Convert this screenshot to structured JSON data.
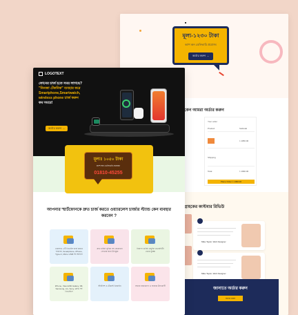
{
  "back_page": {
    "price_badge": {
      "title": "মূল্য-১২৩০ টাকা",
      "subtitle": "ক্যাশ অন ডেলিভারি প্রযোজ্য",
      "button": "অর্ডার করুন →"
    },
    "order_section_title": "কেন আমরা অর্ডার করুন",
    "order_box": {
      "heading": "Your order",
      "col_product": "Product",
      "col_subtotal": "Subtotal",
      "shipping_label": "Shipping",
      "total_label": "Total",
      "total_value": "৳ 1090.00",
      "subtotal_value": "৳ 1050.00",
      "place_order": "Place Order ৳ 1090.00"
    },
    "review_title": "গ্রাহকের কাস্টমার রিভিউ",
    "reviews": [
      {
        "name": "Mike Taylor, Web Designer"
      },
      {
        "name": "Mike Taylor, Web Designer"
      }
    ],
    "navy_panel": {
      "title": "জানাতে অর্ডার করুন",
      "button": "অর্ডার করুন"
    }
  },
  "front_page": {
    "logo": "LOGOTEXT",
    "hero_lines": [
      "ফোনের চার্জ হতে সময় লাগছে?",
      "\"নিনজা টেকনিক\" ব্যবহার করে",
      "Smartphone,Smartwatch,",
      "wireless phone চার্জ করুন",
      "কম সময়ে!"
    ],
    "hero_button": "অর্ডার করুন →",
    "watch_time": "7:09",
    "price_card": {
      "price": "মূল্যঃ ১০৫০ টাকা",
      "note": "ক্যাশ অন ডেলিভারি প্রযোজ্য",
      "phone": "01810-45255"
    },
    "question": "আপনার স্মার্টফোনকে দ্রুত চার্জ করতে ওয়্যারলেস চার্জার স্ট্যান্ড কেন ব্যবহার করবেন ?",
    "tiles": [
      {
        "text": "একসাথে ৩টি ডিভাইস চার্জ করতে পারবেন, Smartphone, iPhone, Type-C, Micro USB সহ অন্যান্য",
        "color": "#e4f1fb"
      },
      {
        "text": "দ্রুত চার্জিং সুবিধা সহ যেকোনো ফোনের জন্য উপযুক্ত",
        "color": "#f9e3ea"
      },
      {
        "text": "নিরাপদ চার্জিং প্রযুক্তি ওভারহিটিং থেকে সুরক্ষা",
        "color": "#eaf5e2"
      },
      {
        "text": "iPhone, Xiaomi/Mi Galaxy, S8, Samsung, LG, Sony, HTC সব ডিভাইসে",
        "color": "#eef7e6"
      },
      {
        "text": "স্টাইলিশ ও টেকসই ডিজাইন",
        "color": "#e4f1fb"
      },
      {
        "text": "সহজে বহনযোগ্য ও ব্যবহার উপযোগী",
        "color": "#fbe4ea"
      }
    ]
  },
  "colors": {
    "accent": "#f4b400",
    "navy": "#1d2b5a",
    "background": "#f2d6c8"
  }
}
